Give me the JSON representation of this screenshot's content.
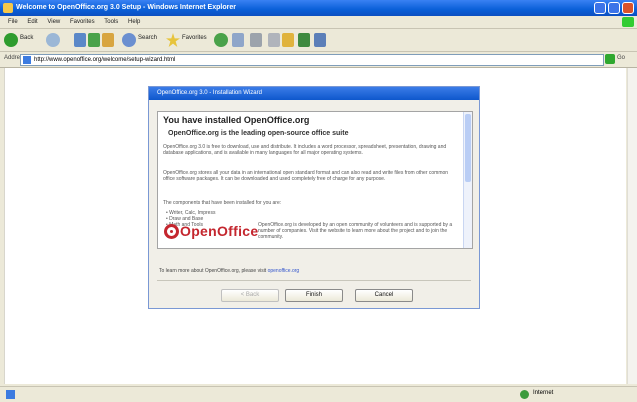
{
  "window": {
    "title": "Welcome to OpenOffice.org 3.0 Setup - Windows Internet Explorer"
  },
  "menu": {
    "items": [
      "File",
      "Edit",
      "View",
      "Favorites",
      "Tools",
      "Help"
    ]
  },
  "toolbar": {
    "back_label": "Back",
    "search_label": "Search",
    "favorites_label": "Favorites"
  },
  "address": {
    "label": "Address",
    "url": "http://www.openoffice.org/welcome/setup-wizard.html",
    "go_label": "Go",
    "links_label": "Links"
  },
  "dialog": {
    "title": "OpenOffice.org 3.0 - Installation Wizard",
    "heading": "You have installed OpenOffice.org",
    "tagline": "OpenOffice.org is the leading open-source office suite",
    "para1": "OpenOffice.org 3.0 is free to download, use and distribute. It includes a word processor, spreadsheet, presentation, drawing and database applications, and is available in many languages for all major operating systems.",
    "para2": "OpenOffice.org stores all your data in an international open standard format and can also read and write files from other common office software packages. It can be downloaded and used completely free of charge for any purpose.",
    "list_intro": "The components that have been installed for you are:",
    "bullets": [
      "Writer, Calc, Impress",
      "Draw and Base",
      "Math and Tools"
    ],
    "logo_text": "OpenOffice",
    "logo_desc": "OpenOffice.org is developed by an open community of volunteers and is supported by a number of companies. Visit the website to learn more about the project and to join the community.",
    "footer_text": "To learn more about OpenOffice.org, please visit",
    "footer_link": "openoffice.org",
    "back_button": "< Back",
    "finish_button": "Finish",
    "cancel_button": "Cancel"
  },
  "status": {
    "zone": "Internet"
  },
  "colors": {
    "accent": "#0e57cc",
    "logo": "#c4262e"
  }
}
